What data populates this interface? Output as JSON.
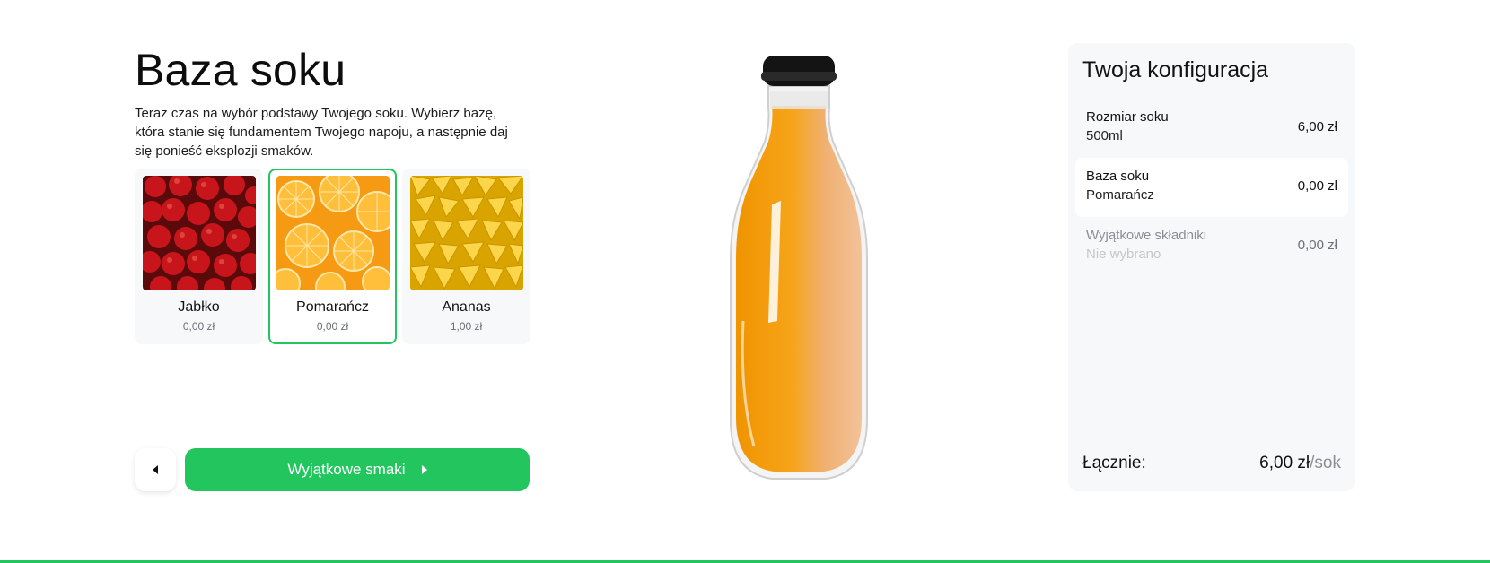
{
  "step": {
    "title": "Baza soku",
    "description": "Teraz czas na wybór podstawy Twojego soku. Wybierz bazę, która stanie się fundamentem Twojego napoju, a następnie daj się ponieść eksplozji smaków."
  },
  "options": [
    {
      "name": "Jabłko",
      "price": "0,00 zł",
      "image": "apples-image",
      "selected": false
    },
    {
      "name": "Pomarańcz",
      "price": "0,00 zł",
      "image": "oranges-image",
      "selected": true
    },
    {
      "name": "Ananas",
      "price": "1,00 zł",
      "image": "pineapple-image",
      "selected": false
    }
  ],
  "navigation": {
    "back_icon": "chevron-left-icon",
    "next_label": "Wyjątkowe smaki",
    "next_icon": "chevron-right-icon"
  },
  "preview": {
    "image": "juice-bottle-image",
    "juice_color": "#f7a41a"
  },
  "summary": {
    "title": "Twoja konfiguracja",
    "rows": [
      {
        "label": "Rozmiar soku",
        "value": "500ml",
        "price": "6,00 zł"
      },
      {
        "label": "Baza soku",
        "value": "Pomarańcz",
        "price": "0,00 zł"
      },
      {
        "label": "Wyjątkowe składniki",
        "value": "Nie wybrano",
        "price": "0,00 zł"
      }
    ],
    "total_label": "Łącznie:",
    "total_price": "6,00 zł",
    "total_unit": "/sok"
  },
  "colors": {
    "accent": "#22c55e",
    "panel": "#f7f8fa"
  }
}
